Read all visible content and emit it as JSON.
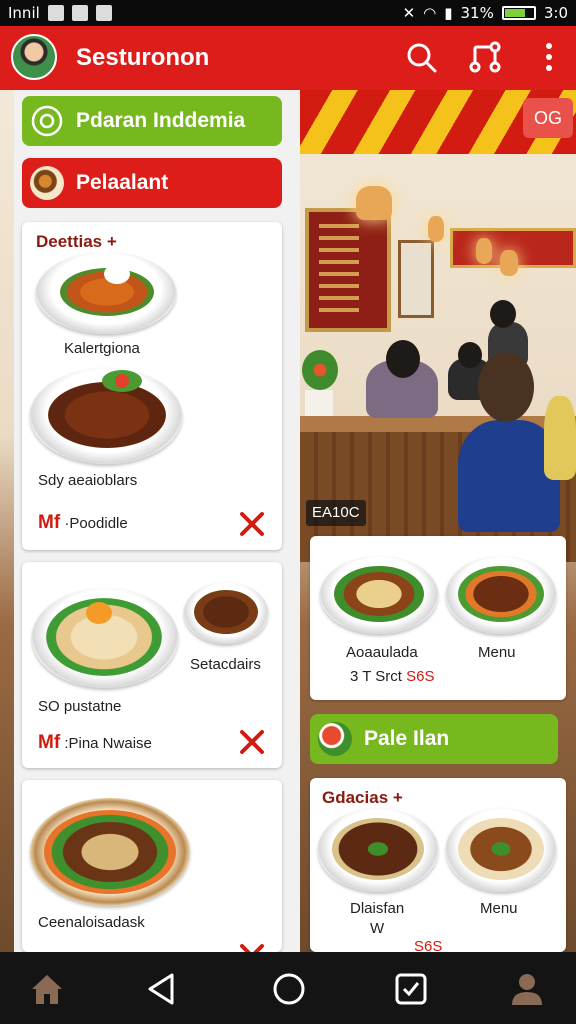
{
  "status_bar": {
    "carrier": "Innil",
    "battery": "31%",
    "time": "3:0"
  },
  "app_bar": {
    "title": "Sesturonon"
  },
  "photo": {
    "badge": "OG",
    "caption": "EA10C"
  },
  "left_panel": {
    "pills": [
      {
        "label": "Pdaran Inddemia",
        "color": "#78b81f"
      },
      {
        "label": "Pelaalant",
        "color": "#dd1d1a"
      }
    ],
    "card1": {
      "header": "Deettias +",
      "dish1": "Kalertgiona",
      "dish2": "Sdy aeaioblars",
      "price_prefix": "Mf",
      "price_text": "·Poodidle"
    },
    "card2": {
      "dish_right": "Setacdairs",
      "dish1": "SO pustatne",
      "price_prefix": "Mf",
      "price_text": ":Pina Nwaise"
    },
    "card3": {
      "dish1": "Ceenaloisadask"
    }
  },
  "right_panel": {
    "card1": {
      "item1": "Aoaaulada",
      "item1_sub": "3 T Srct",
      "item1_price": "S6S",
      "item2": "Menu"
    },
    "pill": {
      "label": "Pale Ilan",
      "color": "#78b81f"
    },
    "card2": {
      "header": "Gdacias +",
      "item1": "Dlaisfan",
      "item1_sub": "W",
      "item2": "Menu",
      "price": "S6S"
    }
  },
  "colors": {
    "brand_red": "#dd1d1a",
    "accent_green": "#78b81f",
    "price_red": "#d11b12"
  }
}
